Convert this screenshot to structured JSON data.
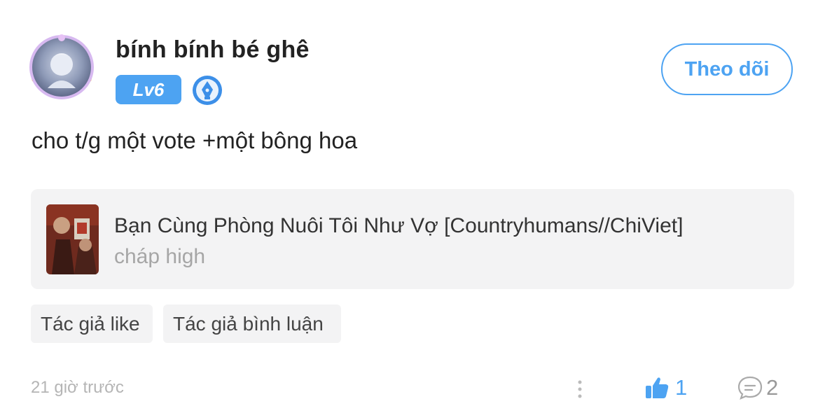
{
  "user": {
    "name": "bính bính bé ghê",
    "level": "Lv6",
    "avatar_icon": "avatar-image",
    "badge_icon": "pen-badge-icon"
  },
  "follow_button": {
    "label": "Theo dõi"
  },
  "comment": {
    "text": "cho t/g một vote +một bông hoa"
  },
  "book": {
    "title": "Bạn Cùng Phòng Nuôi Tôi Như Vợ [Countryhumans//ChiViet]",
    "chapter": "cháp high"
  },
  "tags": [
    "Tác giả like",
    "Tác giả bình luận"
  ],
  "footer": {
    "timestamp": "21 giờ trước",
    "like_count": "1",
    "comment_count": "2"
  },
  "colors": {
    "accent": "#4da3f2",
    "card_bg": "#f3f3f4",
    "muted": "#b5b5b5"
  }
}
